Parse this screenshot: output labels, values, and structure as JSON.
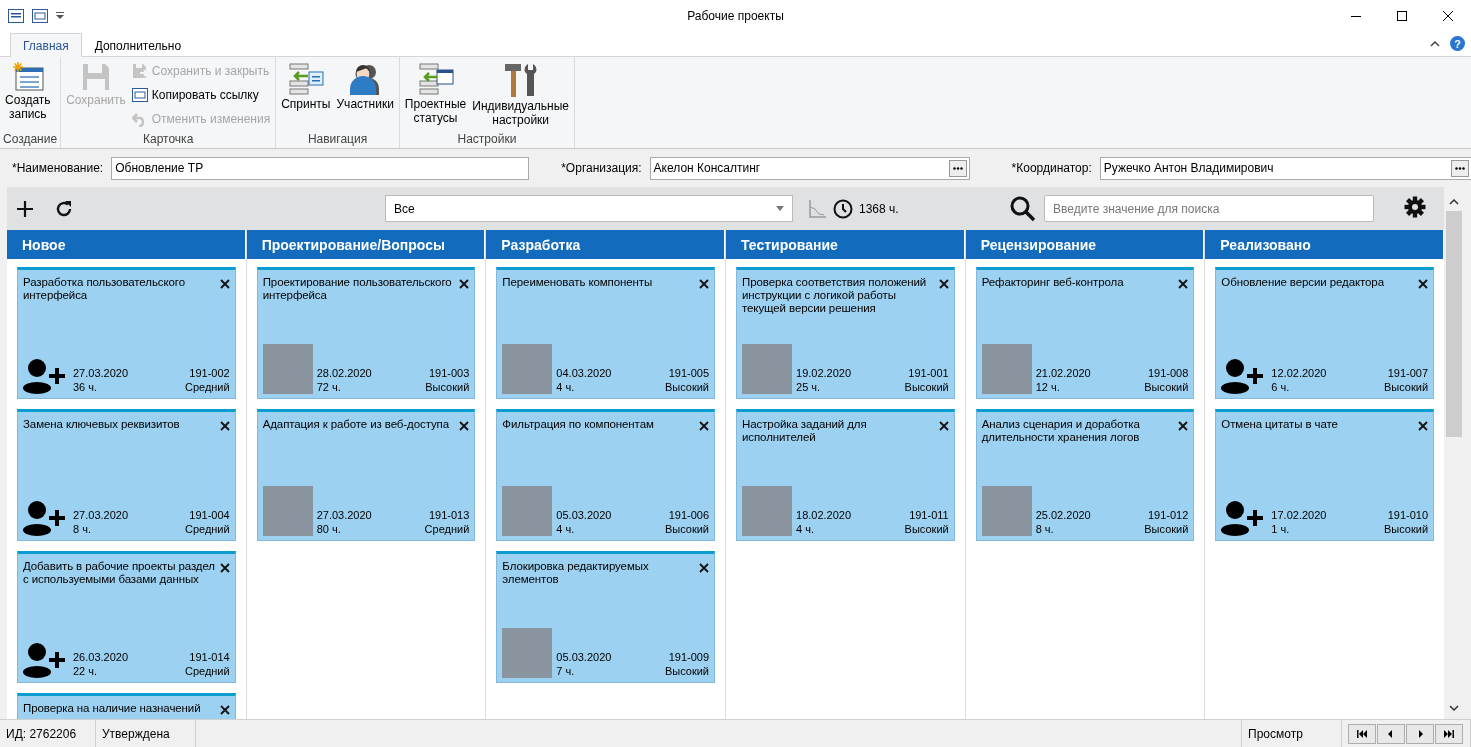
{
  "window": {
    "title": "Рабочие проекты"
  },
  "ribbon": {
    "tabs": [
      {
        "label": "Главная",
        "selected": true
      },
      {
        "label": "Дополнительно",
        "selected": false
      }
    ],
    "help_label": "?",
    "groups": [
      {
        "label": "Создание",
        "items": [
          {
            "label": "Создать запись",
            "kind": "large",
            "disabled": false
          }
        ]
      },
      {
        "label": "Карточка",
        "items": [
          {
            "label": "Сохранить",
            "kind": "large",
            "disabled": true
          },
          {
            "label": "Сохранить и закрыть",
            "kind": "small",
            "disabled": true
          },
          {
            "label": "Копировать ссылку",
            "kind": "small",
            "disabled": false
          },
          {
            "label": "Отменить изменения",
            "kind": "small",
            "disabled": true
          }
        ]
      },
      {
        "label": "Навигация",
        "items": [
          {
            "label": "Спринты",
            "kind": "large",
            "disabled": false
          },
          {
            "label": "Участники",
            "kind": "large",
            "disabled": false
          }
        ]
      },
      {
        "label": "Настройки",
        "items": [
          {
            "label": "Проектные статусы",
            "kind": "large",
            "disabled": false
          },
          {
            "label": "Индивидуальные настройки",
            "kind": "large",
            "disabled": false
          }
        ]
      }
    ]
  },
  "fields": [
    {
      "label": "*Наименование:",
      "value": "Обновление ТР",
      "picker": false
    },
    {
      "label": "*Организация:",
      "value": "Акелон Консалтинг",
      "picker": true
    },
    {
      "label": "*Координатор:",
      "value": "Ружечко Антон Владимирович",
      "picker": true
    }
  ],
  "board_toolbar": {
    "filter": "Все",
    "total_hours": "1368 ч.",
    "search_placeholder": "Введите значение для поиска"
  },
  "columns": [
    {
      "title": "Новое",
      "cards": [
        {
          "title": "Разработка пользовательского интерфейса",
          "kind": "unassigned",
          "date": "27.03.2020",
          "hours": "36 ч.",
          "code": "191-002",
          "priority": "Средний"
        },
        {
          "title": "Замена ключевых реквизитов",
          "kind": "unassigned",
          "date": "27.03.2020",
          "hours": "8 ч.",
          "code": "191-004",
          "priority": "Средний"
        },
        {
          "title": "Добавить в рабочие проекты раздел с используемыми базами данных",
          "kind": "unassigned",
          "date": "26.03.2020",
          "hours": "22 ч.",
          "code": "191-014",
          "priority": "Средний"
        },
        {
          "title": "Проверка на наличие назначений"
        }
      ]
    },
    {
      "title": "Проектирование/Вопросы",
      "cards": [
        {
          "title": "Проектирование пользовательского интерфейса",
          "kind": "photo",
          "date": "28.02.2020",
          "hours": "72 ч.",
          "code": "191-003",
          "priority": "Высокий"
        },
        {
          "title": "Адаптация к работе из веб-доступа",
          "kind": "photo",
          "date": "27.03.2020",
          "hours": "80 ч.",
          "code": "191-013",
          "priority": "Средний"
        }
      ]
    },
    {
      "title": "Разработка",
      "cards": [
        {
          "title": "Переименовать компоненты",
          "kind": "photo",
          "date": "04.03.2020",
          "hours": "4 ч.",
          "code": "191-005",
          "priority": "Высокий"
        },
        {
          "title": "Фильтрация по компонентам",
          "kind": "photo",
          "date": "05.03.2020",
          "hours": "4 ч.",
          "code": "191-006",
          "priority": "Высокий"
        },
        {
          "title": "Блокировка редактируемых элементов",
          "kind": "photo",
          "date": "05.03.2020",
          "hours": "7 ч.",
          "code": "191-009",
          "priority": "Высокий"
        }
      ]
    },
    {
      "title": "Тестирование",
      "cards": [
        {
          "title": "Проверка соответствия положений инструкции с логикой работы текущей версии решения",
          "kind": "photo",
          "date": "19.02.2020",
          "hours": "25 ч.",
          "code": "191-001",
          "priority": "Высокий"
        },
        {
          "title": "Настройка заданий для исполнителей",
          "kind": "photo",
          "date": "18.02.2020",
          "hours": "4 ч.",
          "code": "191-011",
          "priority": "Высокий"
        }
      ]
    },
    {
      "title": "Рецензирование",
      "cards": [
        {
          "title": "Рефакторинг веб-контрола",
          "kind": "photo",
          "date": "21.02.2020",
          "hours": "12 ч.",
          "code": "191-008",
          "priority": "Высокий"
        },
        {
          "title": "Анализ сценария и доработка длительности хранения логов",
          "kind": "photo",
          "date": "25.02.2020",
          "hours": "8 ч.",
          "code": "191-012",
          "priority": "Высокий"
        }
      ]
    },
    {
      "title": "Реализовано",
      "cards": [
        {
          "title": "Обновление версии редактора",
          "kind": "unassigned",
          "date": "12.02.2020",
          "hours": "6 ч.",
          "code": "191-007",
          "priority": "Высокий"
        },
        {
          "title": "Отмена цитаты в чате",
          "kind": "unassigned",
          "date": "17.02.2020",
          "hours": "1 ч.",
          "code": "191-010",
          "priority": "Высокий"
        }
      ]
    }
  ],
  "status_bar": {
    "id": "ИД: 2762206",
    "state": "Утверждена",
    "mode": "Просмотр"
  }
}
